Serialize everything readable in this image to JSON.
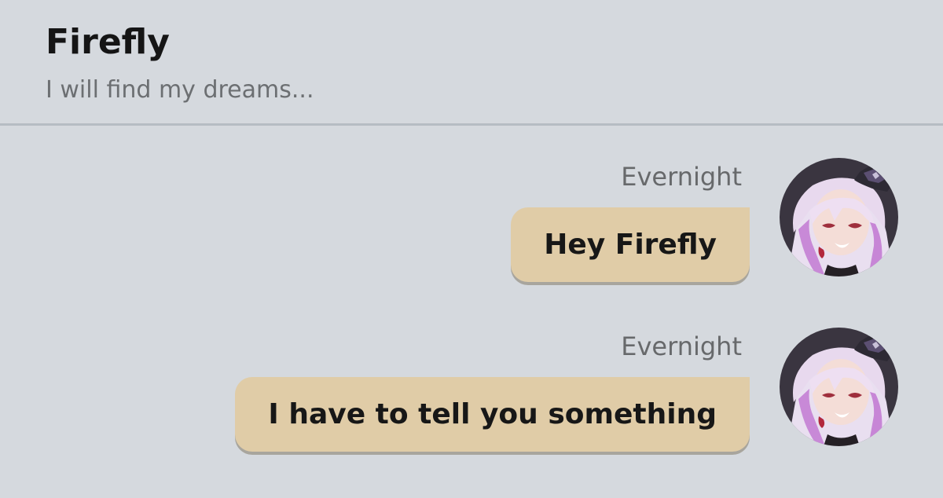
{
  "header": {
    "title": "Firefly",
    "subtitle": "I will find my dreams..."
  },
  "messages": [
    {
      "sender": "Evernight",
      "text": "Hey Firefly",
      "avatar_icon": "anime-character-avatar"
    },
    {
      "sender": "Evernight",
      "text": "I have to tell you something",
      "avatar_icon": "anime-character-avatar"
    }
  ],
  "colors": {
    "background": "#d5d9de",
    "bubble": "#e0cca7",
    "divider": "#b6bcc3",
    "sender_text": "#67696b",
    "subtitle_text": "#6c6f72"
  }
}
